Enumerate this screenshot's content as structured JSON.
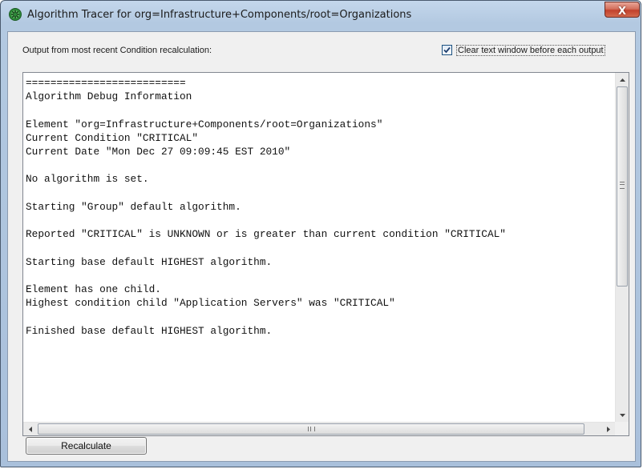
{
  "window": {
    "title": "Algorithm Tracer for org=Infrastructure+Components/root=Organizations",
    "close_symbol": "X",
    "icon": "green-gear-icon"
  },
  "header": {
    "output_label": "Output from most recent Condition recalculation:",
    "clear_checkbox_label": "Clear text window before each output",
    "clear_checkbox_checked": true
  },
  "output": {
    "text": "==========================\nAlgorithm Debug Information\n\nElement \"org=Infrastructure+Components/root=Organizations\"\nCurrent Condition \"CRITICAL\"\nCurrent Date \"Mon Dec 27 09:09:45 EST 2010\"\n\nNo algorithm is set.\n\nStarting \"Group\" default algorithm.\n\nReported \"CRITICAL\" is UNKNOWN or is greater than current condition \"CRITICAL\"\n\nStarting base default HIGHEST algorithm.\n\nElement has one child.\nHighest condition child \"Application Servers\" was \"CRITICAL\"\n\nFinished base default HIGHEST algorithm."
  },
  "footer": {
    "recalculate_label": "Recalculate"
  },
  "colors": {
    "titlebar": "#b9cde4",
    "close_button": "#c8462f",
    "client_bg": "#f0f0f0"
  }
}
